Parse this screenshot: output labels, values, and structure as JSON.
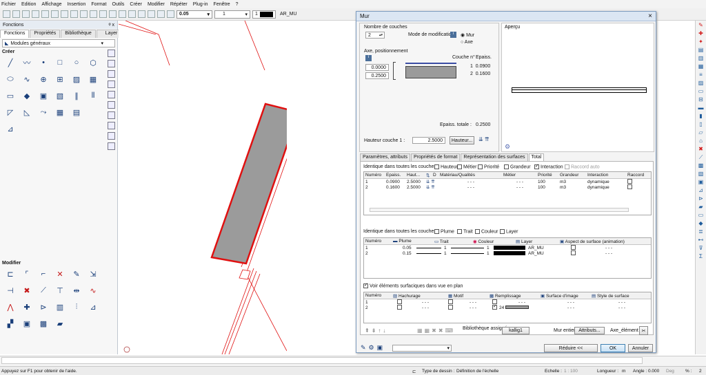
{
  "menu": [
    "Fichier",
    "Edition",
    "Affichage",
    "Insertion",
    "Format",
    "Outils",
    "Créer",
    "Modifier",
    "Répéter",
    "Plug-in",
    "Fenêtre",
    "?"
  ],
  "toolbar": {
    "pen": "0.05",
    "line": "1",
    "color": "1",
    "layer": "AR_MU"
  },
  "left_panel": {
    "title": "Fonctions",
    "pin": "ᵠ x",
    "tabs": [
      "Fonctions",
      "Propriétés",
      "Bibliothèque",
      "Layer"
    ],
    "module": "Modules généraux",
    "creer_label": "Créer",
    "modifier_label": "Modifier"
  },
  "dialog": {
    "title": "Mur",
    "close": "×",
    "layers_count_label": "Nombre de couches",
    "layers_count": "2",
    "mode_label": "Mode de modification",
    "mode_options": [
      "Mur",
      "Axe"
    ],
    "axis_label": "Axe, positionnement",
    "axis_values": [
      "0.0000",
      "0.2500"
    ],
    "couche_header": "Couche n°",
    "epaiss_header": "Epaiss.",
    "couches": [
      {
        "n": "1",
        "e": "0.0900"
      },
      {
        "n": "2",
        "e": "0.1600"
      }
    ],
    "total_label": "Epaiss. totale :",
    "total_value": "0.2500",
    "height_label": "Hauteur couche 1 :",
    "height_value": "2.5000",
    "height_btn": "Hauteur...",
    "apercu_label": "Aperçu",
    "tabs": [
      "Paramètres, attributs",
      "Propriétés de format",
      "Représentation des surfaces",
      "Total"
    ],
    "identique1_label": "Identique dans toutes les couches :",
    "identique1_opts": [
      {
        "label": "Hauteur",
        "checked": false
      },
      {
        "label": "Métier",
        "checked": false
      },
      {
        "label": "Priorité",
        "checked": false
      },
      {
        "label": "Grandeur",
        "checked": false
      },
      {
        "label": "Interaction",
        "checked": true
      },
      {
        "label": "Raccord auto",
        "checked": false
      }
    ],
    "table1_headers": [
      "Numéro",
      "Epaiss.",
      "Haut...",
      "",
      "D",
      "Matériau/Qualités",
      "Métier",
      "Priorité",
      "Grandeur",
      "Interaction",
      "Raccord"
    ],
    "table1_rows": [
      [
        "1",
        "0.0900",
        "2.5000",
        "",
        "",
        "- - -",
        "- - -",
        "100",
        "m3",
        "dynamique",
        ""
      ],
      [
        "2",
        "0.1600",
        "2.5000",
        "",
        "",
        "- - -",
        "- - -",
        "100",
        "m3",
        "dynamique",
        ""
      ]
    ],
    "identique2_label": "Identique dans toutes les couches :",
    "identique2_opts": [
      "Plume",
      "Trait",
      "Couleur",
      "Layer"
    ],
    "table2_headers": [
      "Numéro",
      "Plume",
      "Trait",
      "Couleur",
      "Layer",
      "Aspect de surface (animation)"
    ],
    "table2_rows": [
      [
        "1",
        "0.05",
        "1",
        "1",
        "AR_MU",
        "- - -"
      ],
      [
        "2",
        "0.15",
        "1",
        "1",
        "AR_MU",
        "- - -"
      ]
    ],
    "voir_label": "Voir éléments surfaciques dans vue en plan",
    "table3_headers": [
      "Numéro",
      "Hachurage",
      "Motif",
      "Remplissage",
      "Surface d'image",
      "Style de surface"
    ],
    "table3_rows": [
      [
        "1",
        "- - -",
        "- - -",
        "- - -",
        "- - -",
        "- - -"
      ],
      [
        "2",
        "- - -",
        "- - -",
        "24",
        "- - -",
        "- - -"
      ]
    ],
    "biblio_label": "Bibliothèque assignée",
    "biblio_btn": "kallig1",
    "mur_entier_label": "Mur entier",
    "attributs_btn": "Attributs...",
    "axe_element_label": "Axe_élément",
    "reduire_btn": "Réduire <<",
    "ok_btn": "OK",
    "annuler_btn": "Annuler"
  },
  "status": {
    "help": "Appuyez sur F1 pour obtenir de l'aide.",
    "type_label": "Type de dessin :",
    "type_value": "Définition de l'échelle",
    "echelle_label": "Echelle :",
    "echelle_value": "1 : 100",
    "longueur_label": "Longueur :",
    "longueur_unit": "m",
    "angle_label": "Angle :",
    "angle_value": "0.000",
    "angle_unit": "Deg",
    "percent_label": "% :",
    "percent_value": "2"
  },
  "colors": {
    "wall_red": "#e01010",
    "fill_gray": "#9b9b9b",
    "accent": "#1a3f7a"
  }
}
